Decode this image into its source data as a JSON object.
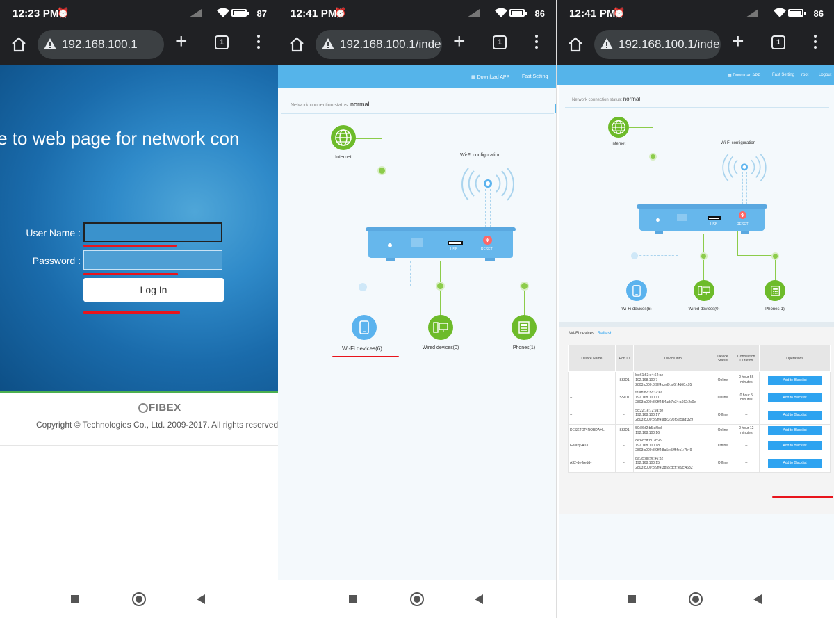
{
  "screens": [
    {
      "time": "12:23 PM",
      "battery": "87",
      "battery_fill": 0.87,
      "url": "192.168.100.1"
    },
    {
      "time": "12:41 PM",
      "battery": "86",
      "battery_fill": 0.86,
      "url": "192.168.100.1/inde"
    },
    {
      "time": "12:41 PM",
      "battery": "86",
      "battery_fill": 0.86,
      "url": "192.168.100.1/inde"
    }
  ],
  "browser": {
    "tab_count": "1"
  },
  "login": {
    "welcome": "ome to web page for network con",
    "username_label": "User Name :",
    "password_label": "Password :",
    "login_button": "Log In",
    "brand": "FIBEX",
    "copyright": "Copyright © Technologies Co., Ltd. 2009-2017. All rights reserved"
  },
  "router": {
    "download_app": "Download APP",
    "fast_setting": "Fast Setting",
    "root": "root",
    "logout": "Logout",
    "net_status_label": "Network connection status:",
    "net_status_value": "normal",
    "internet": "Internet",
    "wifi_config": "Wi-Fi configuration",
    "usb": "USB",
    "reset": "RESET",
    "wifi_devices": "Wi-Fi devices(6)",
    "wired_devices": "Wired devices(0)",
    "phones": "Phones(1)"
  },
  "devices": {
    "title": "Wi-Fi devices",
    "refresh": "Refresh",
    "headers": [
      "Device Name",
      "Port ID",
      "Device Info",
      "Device Status",
      "Connection Duration",
      "Operations"
    ],
    "rows": [
      {
        "name": "--",
        "port": "SSID1",
        "info": [
          "bc:61:53:e4:64:ae",
          "192.168.100.7",
          "2803:c000:8:9ff4:ced9:af6f:4d60:c95"
        ],
        "status": "Online",
        "duration": "0 hour 56 minutes",
        "op": "Add to Blacklist"
      },
      {
        "name": "--",
        "port": "SSID1",
        "info": [
          "f8:ab:82:32:37:ea",
          "192.168.100.11",
          "2803:c000:8:9ff4:54ad:7b34:a662:2c0e"
        ],
        "status": "Online",
        "duration": "0 hour 5 minutes",
        "op": "Add to Blacklist"
      },
      {
        "name": "--",
        "port": "--",
        "info": [
          "5c:22:1e:72:9a:de",
          "192.168.100.17",
          "2803:c000:8:9ff4:adc3:95f5:a5ad:329"
        ],
        "status": "Offline",
        "duration": "--",
        "op": "Add to Blacklist"
      },
      {
        "name": "DESKTOP-ROBDAHL",
        "port": "SSID1",
        "info": [
          "50:86:f2:b5:af:bd",
          "192.168.100.16"
        ],
        "status": "Online",
        "duration": "0 hour 12 minutes",
        "op": "Add to Blacklist"
      },
      {
        "name": "Galaxy-A03",
        "port": "--",
        "info": [
          "8e:6d:9f:c1:7b:49",
          "192.168.100.18",
          "2803:c000:8:9ff4:8a5e:5fff:fec1:7b49"
        ],
        "status": "Offline",
        "duration": "--",
        "op": "Add to Blacklist"
      },
      {
        "name": "A32-de-freddy",
        "port": "--",
        "info": [
          "ba:35:dd:9c:46:32",
          "192.168.100.15",
          "2803:c000:8:9ff4:3855:dcff:fe9c:4632"
        ],
        "status": "Offline",
        "duration": "--",
        "op": "Add to Blacklist"
      }
    ]
  },
  "colors": {
    "router_blue": "#55b4ea",
    "green": "#6dbb2a",
    "annotation_red": "#e8141c",
    "button_blue": "#2ea3f0"
  }
}
